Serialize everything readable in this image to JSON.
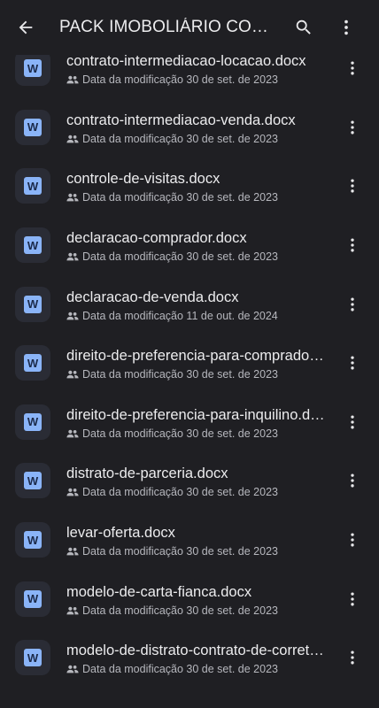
{
  "header": {
    "title": "PACK IMOBOLIÁRIO CONTRATOS",
    "back_icon": "arrow-back-icon",
    "search_icon": "search-icon",
    "more_icon": "more-vert-icon"
  },
  "files": [
    {
      "name": "contrato-intermediacao-locacao.docx",
      "meta": "Data da modificação 30 de set. de 2023",
      "badge": "W"
    },
    {
      "name": "contrato-intermediacao-venda.docx",
      "meta": "Data da modificação 30 de set. de 2023",
      "badge": "W"
    },
    {
      "name": "controle-de-visitas.docx",
      "meta": "Data da modificação 30 de set. de 2023",
      "badge": "W"
    },
    {
      "name": "declaracao-comprador.docx",
      "meta": "Data da modificação 30 de set. de 2023",
      "badge": "W"
    },
    {
      "name": "declaracao-de-venda.docx",
      "meta": "Data da modificação 11 de out. de 2024",
      "badge": "W"
    },
    {
      "name": "direito-de-preferencia-para-comprador.docx",
      "meta": "Data da modificação 30 de set. de 2023",
      "badge": "W"
    },
    {
      "name": "direito-de-preferencia-para-inquilino.docx",
      "meta": "Data da modificação 30 de set. de 2023",
      "badge": "W"
    },
    {
      "name": "distrato-de-parceria.docx",
      "meta": "Data da modificação 30 de set. de 2023",
      "badge": "W"
    },
    {
      "name": "levar-oferta.docx",
      "meta": "Data da modificação 30 de set. de 2023",
      "badge": "W"
    },
    {
      "name": "modelo-de-carta-fianca.docx",
      "meta": "Data da modificação 30 de set. de 2023",
      "badge": "W"
    },
    {
      "name": "modelo-de-distrato-contrato-de-corretagem.docx",
      "meta": "Data da modificação 30 de set. de 2023",
      "badge": "W"
    }
  ],
  "colors": {
    "background": "#1f1f23",
    "icon_tile": "#2a2c35",
    "word_blue": "#8ab4f8",
    "text_primary": "#ececee",
    "text_secondary": "#b6b7bd"
  }
}
